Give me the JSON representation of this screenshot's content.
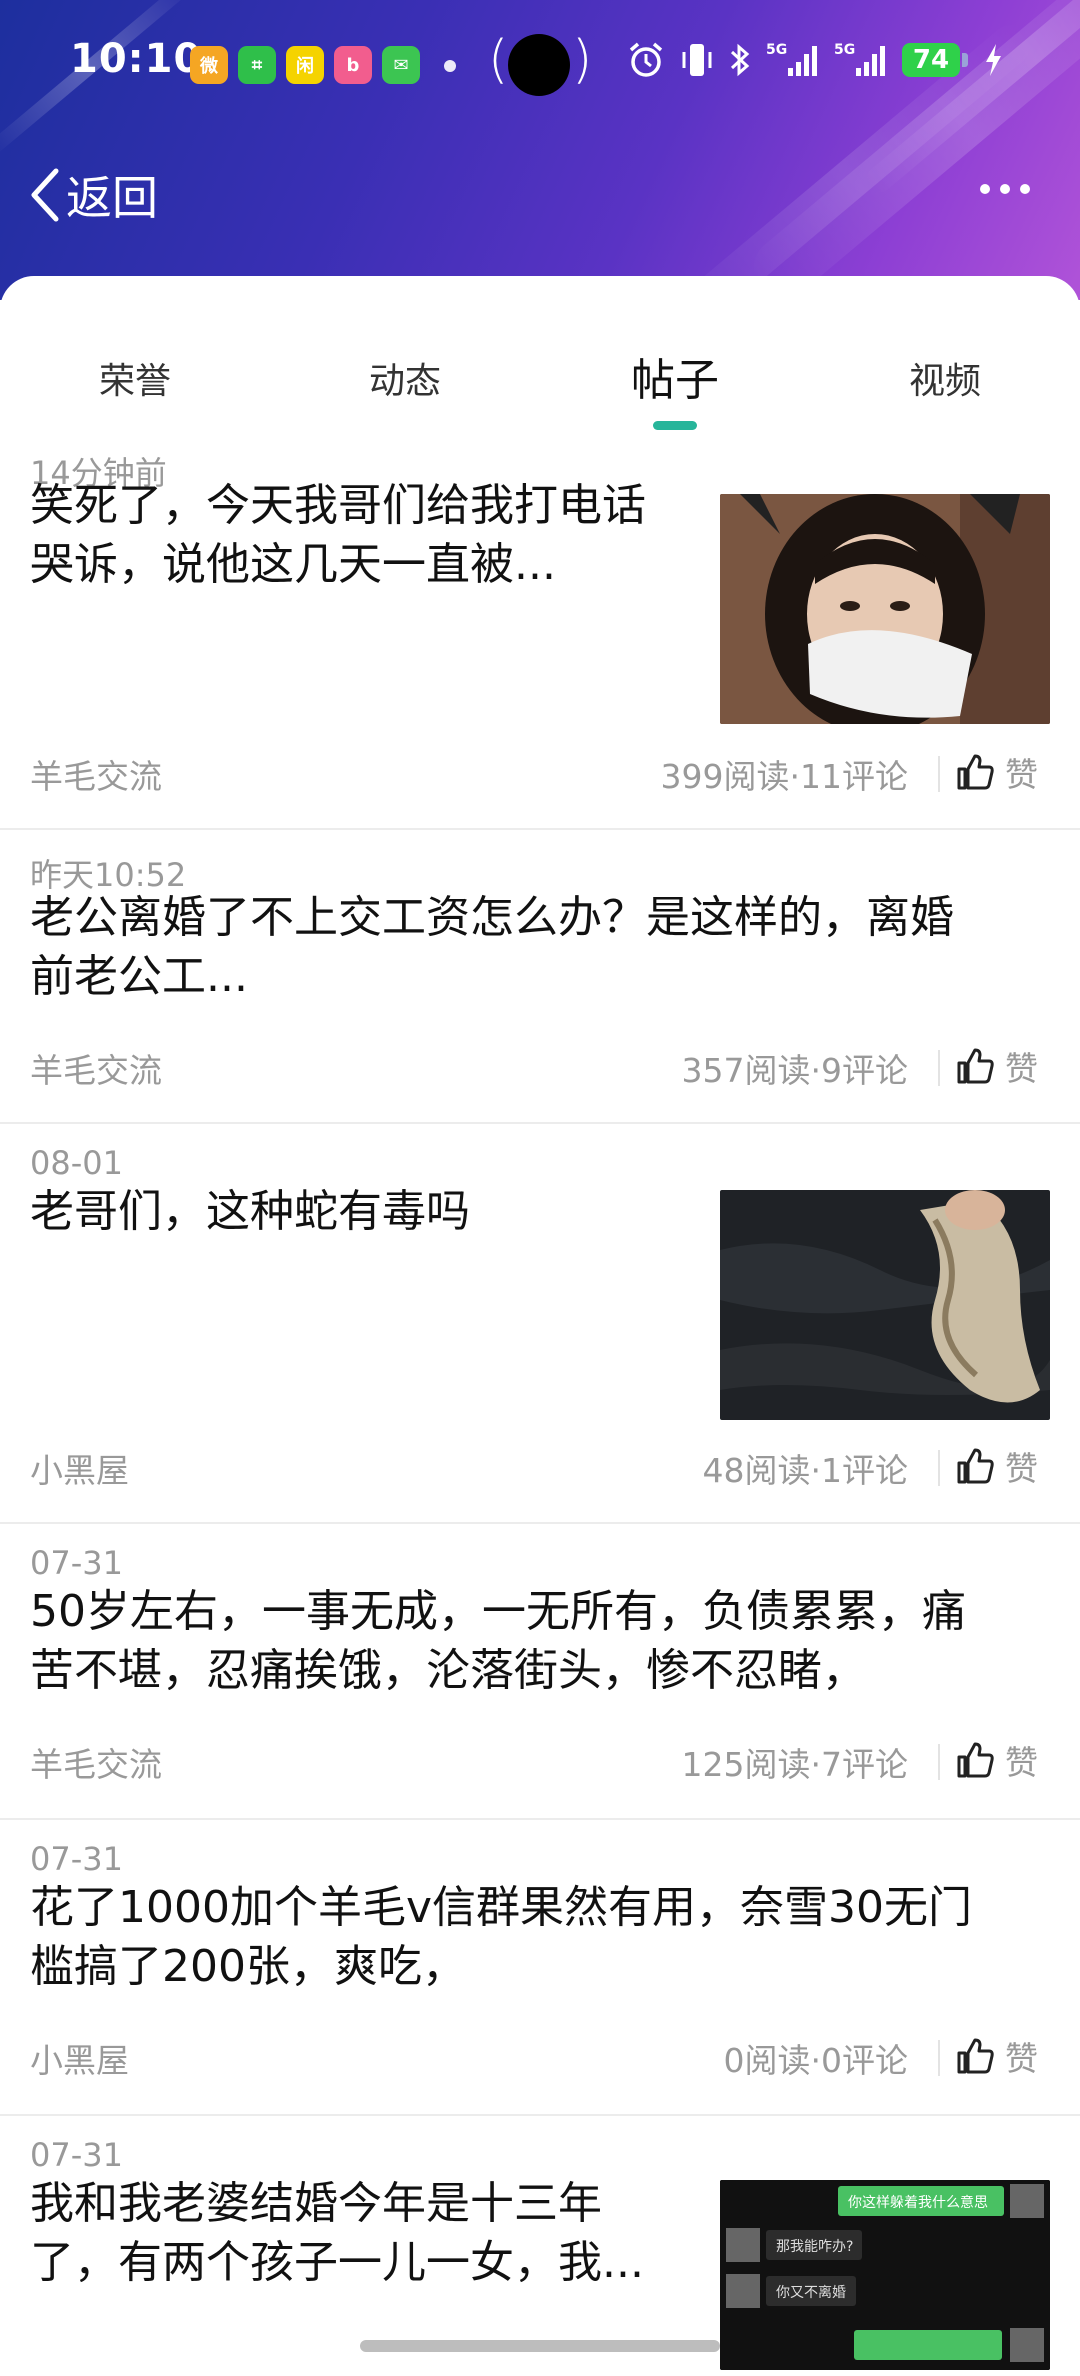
{
  "status_bar": {
    "time": "10:10",
    "app_icons": [
      {
        "name": "weibo-icon",
        "color": "#f5a623",
        "glyph": "微"
      },
      {
        "name": "wechat-mini-icon",
        "color": "#2fbf4a",
        "glyph": "⌗"
      },
      {
        "name": "xianyu-icon",
        "color": "#f5d300",
        "glyph": "闲"
      },
      {
        "name": "bilibili-icon",
        "color": "#f25d8e",
        "glyph": "b"
      },
      {
        "name": "messages-icon",
        "color": "#3cc552",
        "glyph": "✉"
      }
    ],
    "signal_label_1": "5G",
    "signal_label_2": "5G",
    "battery_level": "74"
  },
  "nav": {
    "back_label": "返回"
  },
  "tabs": [
    {
      "label": "荣誉",
      "active": false
    },
    {
      "label": "动态",
      "active": false
    },
    {
      "label": "帖子",
      "active": true
    },
    {
      "label": "视频",
      "active": false
    }
  ],
  "colors": {
    "accent": "#27b59a",
    "text_primary": "#111111",
    "text_secondary": "#999999"
  },
  "posts": [
    {
      "time": "14分钟前",
      "title_line1": "笑死了，今天我哥们给我打电话",
      "title_line2": "哭诉，说他这几天一直被...",
      "thumbnail": "girl-with-cat-ears-photo",
      "category": "羊毛交流",
      "stats": "399阅读·11评论",
      "like_label": "赞"
    },
    {
      "time": "昨天10:52",
      "title_line1": "老公离婚了不上交工资怎么办？是这样的，离婚",
      "title_line2": "前老公工...",
      "thumbnail": "",
      "category": "羊毛交流",
      "stats": "357阅读·9评论",
      "like_label": "赞"
    },
    {
      "time": "08-01",
      "title_line1": "老哥们，这种蛇有毒吗",
      "title_line2": "",
      "thumbnail": "snake-photo",
      "category": "小黑屋",
      "stats": "48阅读·1评论",
      "like_label": "赞"
    },
    {
      "time": "07-31",
      "title_line1": "50岁左右，一事无成，一无所有，负债累累，痛",
      "title_line2": "苦不堪，忍痛挨饿，沦落街头，惨不忍睹，",
      "thumbnail": "",
      "category": "羊毛交流",
      "stats": "125阅读·7评论",
      "like_label": "赞"
    },
    {
      "time": "07-31",
      "title_line1": "花了1000加个羊毛v信群果然有用，奈雪30无门",
      "title_line2": "槛搞了200张，爽吃，",
      "thumbnail": "",
      "category": "小黑屋",
      "stats": "0阅读·0评论",
      "like_label": "赞"
    },
    {
      "time": "07-31",
      "title_line1": "我和我老婆结婚今年是十三年",
      "title_line2": "了，有两个孩子一儿一女，我...",
      "thumbnail": "chat-screenshot",
      "chat_bubbles": [
        "你这样躲着我什么意思",
        "那我能咋办?",
        "你又不离婚"
      ],
      "category": "",
      "stats": "",
      "like_label": ""
    }
  ]
}
